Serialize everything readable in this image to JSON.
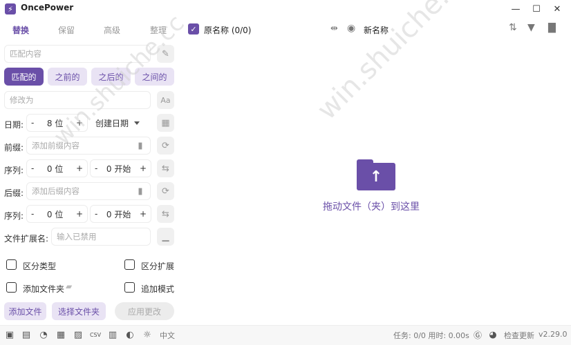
{
  "app": {
    "title": "OncePower",
    "logo_glyph": "⚡"
  },
  "window": {
    "minimize": "—",
    "maximize": "☐",
    "close": "✕"
  },
  "tabs": [
    "替换",
    "保留",
    "高级",
    "整理"
  ],
  "replace": {
    "match_placeholder": "匹配内容",
    "modes": [
      "匹配的",
      "之前的",
      "之后的",
      "之间的"
    ],
    "modify_placeholder": "修改为"
  },
  "date": {
    "label": "日期:",
    "minus": "-",
    "digits": "8 位",
    "plus": "+",
    "type": "创建日期"
  },
  "prefix": {
    "label": "前缀:",
    "placeholder": "添加前缀内容"
  },
  "seq1": {
    "label": "序列:",
    "minus": "-",
    "digits": "0 位",
    "plus": "+",
    "start": "0 开始"
  },
  "suffix": {
    "label": "后缀:",
    "placeholder": "添加后缀内容"
  },
  "seq2": {
    "label": "序列:",
    "minus": "-",
    "digits": "0 位",
    "plus": "+",
    "start": "0 开始"
  },
  "extension": {
    "label": "文件扩展名:",
    "placeholder": "输入已禁用"
  },
  "options": {
    "distinguish_type": "区分类型",
    "distinguish_ext": "区分扩展",
    "add_folder": "添加文件夹",
    "append_mode": "追加模式"
  },
  "buttons": {
    "add_file": "添加文件",
    "select_folder": "选择文件夹",
    "apply": "应用更改"
  },
  "header": {
    "original_name": "原名称 (0/0)",
    "new_name": "新名称"
  },
  "drop": {
    "text": "拖动文件（夹）到这里"
  },
  "watermark": "win.shuiche.cc",
  "status": {
    "lang": "中文",
    "task": "任务: 0/0 用时: 0.00s",
    "check_update": "检查更新",
    "version": "v2.29.0"
  },
  "colors": {
    "accent": "#6a4fa8",
    "accent_light": "#e9e3f4"
  }
}
